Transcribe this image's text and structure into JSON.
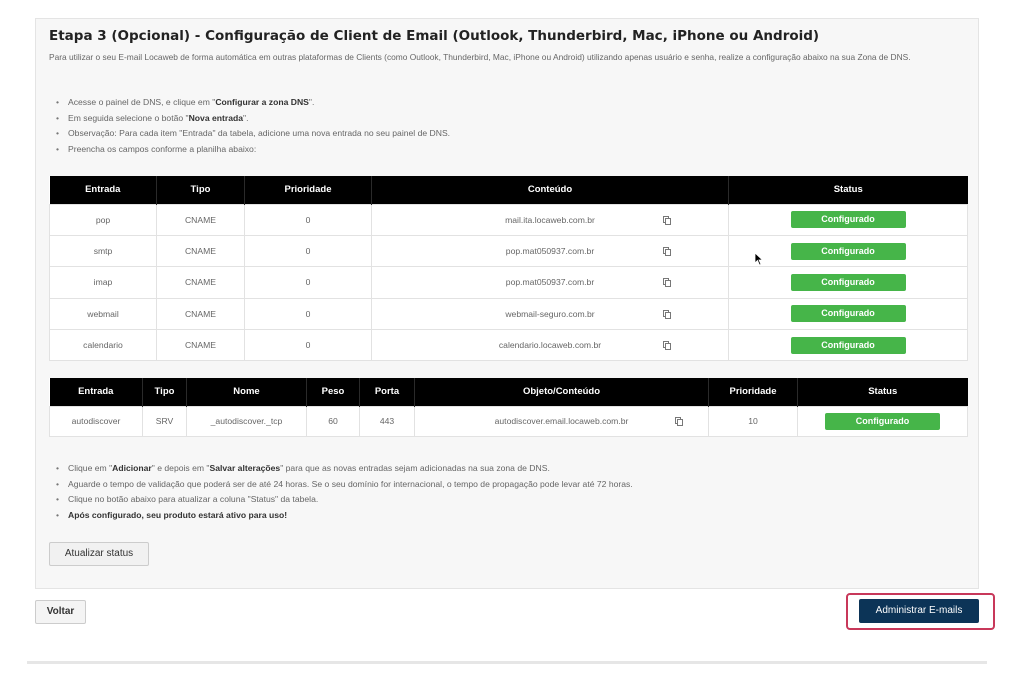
{
  "title": "Etapa 3 (Opcional) - Configuração de Client de Email (Outlook, Thunderbird, Mac, iPhone ou Android)",
  "description": "Para utilizar o seu E-mail Locaweb de forma automática em outras plataformas de Clients (como Outlook, Thunderbird, Mac, iPhone ou Android) utilizando apenas usuário e senha, realize a configuração abaixo na sua Zona de DNS.",
  "instructions": {
    "i1_pre": "Acesse o painel de DNS, e clique em \"",
    "i1_bold": "Configurar a zona DNS",
    "i1_post": "\".",
    "i2_pre": "Em seguida selecione o botão \"",
    "i2_bold": "Nova entrada",
    "i2_post": "\".",
    "i3": "Observação: Para cada item \"Entrada\" da tabela, adicione uma nova entrada no seu painel de DNS.",
    "i4": "Preencha os campos conforme a planilha abaixo:"
  },
  "table1": {
    "headers": [
      "Entrada",
      "Tipo",
      "Prioridade",
      "Conteúdo",
      "Status"
    ],
    "rows": [
      {
        "entrada": "pop",
        "tipo": "CNAME",
        "prioridade": "0",
        "conteudo": "mail.ita.locaweb.com.br",
        "status": "Configurado"
      },
      {
        "entrada": "smtp",
        "tipo": "CNAME",
        "prioridade": "0",
        "conteudo": "pop.mat050937.com.br",
        "status": "Configurado"
      },
      {
        "entrada": "imap",
        "tipo": "CNAME",
        "prioridade": "0",
        "conteudo": "pop.mat050937.com.br",
        "status": "Configurado"
      },
      {
        "entrada": "webmail",
        "tipo": "CNAME",
        "prioridade": "0",
        "conteudo": "webmail-seguro.com.br",
        "status": "Configurado"
      },
      {
        "entrada": "calendario",
        "tipo": "CNAME",
        "prioridade": "0",
        "conteudo": "calendario.locaweb.com.br",
        "status": "Configurado"
      }
    ]
  },
  "table2": {
    "headers": [
      "Entrada",
      "Tipo",
      "Nome",
      "Peso",
      "Porta",
      "Objeto/Conteúdo",
      "Prioridade",
      "Status"
    ],
    "rows": [
      {
        "entrada": "autodiscover",
        "tipo": "SRV",
        "nome": "_autodiscover._tcp",
        "peso": "60",
        "porta": "443",
        "objeto": "autodiscover.email.locaweb.com.br",
        "prioridade": "10",
        "status": "Configurado"
      }
    ]
  },
  "notes": {
    "n1_pre": "Clique em \"",
    "n1_bold1": "Adicionar",
    "n1_mid": "\" e depois em \"",
    "n1_bold2": "Salvar alterações",
    "n1_post": "\" para que as novas entradas sejam adicionadas na sua zona de DNS.",
    "n2": "Aguarde o tempo de validação que poderá ser de até 24 horas. Se o seu domínio for internacional, o tempo de propagação pode levar até 72 horas.",
    "n3": "Clique no botão abaixo para atualizar a coluna \"Status\" da tabela.",
    "n4": "Após configurado, seu produto estará ativo para uso!"
  },
  "buttons": {
    "update_status": "Atualizar status",
    "back": "Voltar",
    "manage_emails": "Administrar E-mails"
  },
  "colors": {
    "status_ok": "#46b549",
    "primary": "#0c3457",
    "highlight": "#c8385a",
    "table_header": "#000000"
  },
  "icons": {
    "copy": "copy-icon",
    "cursor": "mouse-cursor-icon"
  }
}
